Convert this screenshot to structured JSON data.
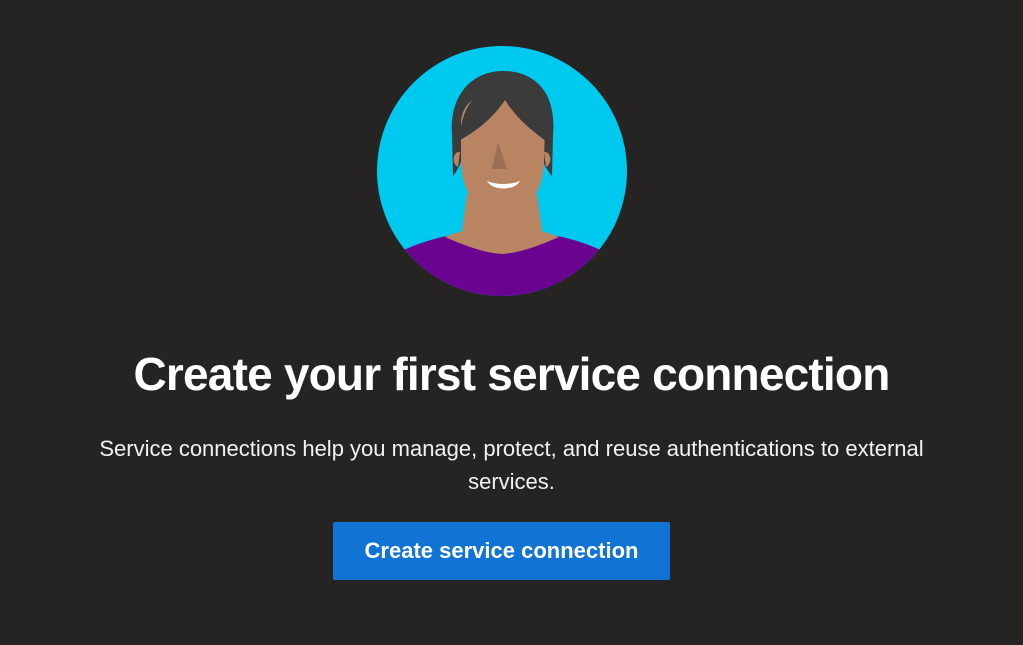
{
  "empty_state": {
    "illustration_icon": "person-avatar-icon",
    "title": "Create your first service connection",
    "description": "Service connections help you manage, protect, and reuse authentications to external services.",
    "primary_action_label": "Create service connection"
  },
  "colors": {
    "background": "#252423",
    "avatar_background": "#00c9f0",
    "button": "#1173d4",
    "shirt": "#6b0391",
    "skin": "#b98461",
    "hair": "#3b3b3b"
  }
}
